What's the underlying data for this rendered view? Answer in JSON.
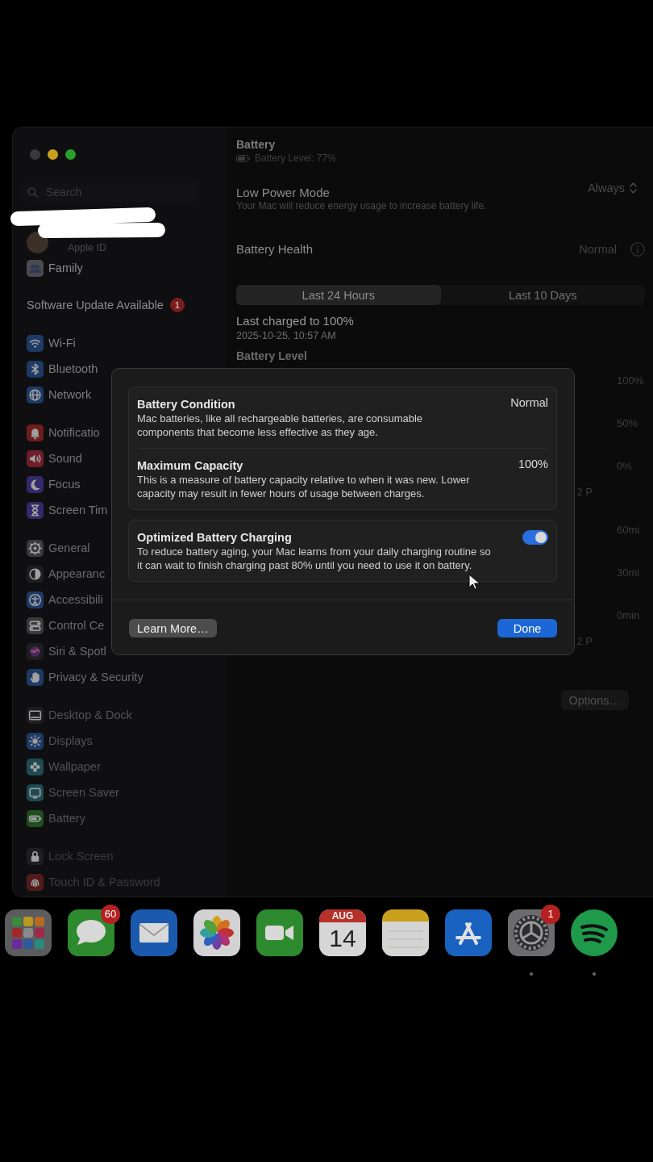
{
  "sidebar": {
    "search": {
      "placeholder": "Search"
    },
    "account": {
      "label": "Apple ID"
    },
    "family": {
      "label": "Family"
    },
    "update_notice": {
      "label": "Software Update Available",
      "badge": "1"
    },
    "groups": [
      {
        "items": [
          {
            "label": "Wi-Fi"
          },
          {
            "label": "Bluetooth"
          },
          {
            "label": "Network"
          }
        ]
      },
      {
        "items": [
          {
            "label": "Notificatio"
          },
          {
            "label": "Sound"
          },
          {
            "label": "Focus"
          },
          {
            "label": "Screen Tim"
          }
        ]
      },
      {
        "items": [
          {
            "label": "General"
          },
          {
            "label": "Appearanc"
          },
          {
            "label": "Accessibili"
          },
          {
            "label": "Control Ce"
          },
          {
            "label": "Siri & Spotl"
          },
          {
            "label": "Privacy & Security"
          }
        ]
      },
      {
        "items": [
          {
            "label": "Desktop & Dock"
          },
          {
            "label": "Displays"
          },
          {
            "label": "Wallpaper"
          },
          {
            "label": "Screen Saver"
          },
          {
            "label": "Battery"
          }
        ]
      },
      {
        "items": [
          {
            "label": "Lock Screen"
          },
          {
            "label": "Touch ID & Password"
          }
        ]
      }
    ]
  },
  "main": {
    "title": "Battery",
    "battery_level": "Battery Level: 77%",
    "low_power_mode": {
      "label": "Low Power Mode",
      "description": "Your Mac will reduce energy usage to increase battery life.",
      "value": "Always"
    },
    "battery_health": {
      "label": "Battery Health",
      "value": "Normal"
    },
    "range_tabs": [
      {
        "label": "Last 24 Hours",
        "selected": true
      },
      {
        "label": "Last 10 Days",
        "selected": false
      }
    ],
    "last_charged": {
      "label": "Last charged to 100%",
      "date": "2025-10-25, 10:57 AM"
    },
    "section_heading": "Battery Level",
    "charts": [
      {
        "y_labels": [
          "100%",
          "50%",
          "0%"
        ],
        "x_label": "2 P"
      },
      {
        "y_labels": [
          "60mi",
          "30mi",
          "0min"
        ],
        "x_label": "2 P"
      }
    ],
    "options_button": "Options…"
  },
  "dialog": {
    "cards": [
      {
        "rows": [
          {
            "kind": "value",
            "title": "Battery Condition",
            "description": "Mac batteries, like all rechargeable batteries, are consumable components that become less effective as they age.",
            "value": "Normal"
          },
          {
            "kind": "value",
            "title": "Maximum Capacity",
            "description": "This is a measure of battery capacity relative to when it was new. Lower capacity may result in fewer hours of usage between charges.",
            "value": "100%"
          }
        ]
      },
      {
        "rows": [
          {
            "kind": "toggle",
            "title": "Optimized Battery Charging",
            "description": "To reduce battery aging, your Mac learns from your daily charging routine so it can wait to finish charging past 80% until you need to use it on battery.",
            "on": true
          }
        ]
      }
    ],
    "buttons": [
      {
        "kind": "secondary",
        "label": "Learn More…"
      },
      {
        "kind": "primary",
        "label": "Done"
      }
    ]
  },
  "dock": {
    "items": [
      {
        "kind": "grid",
        "running": false
      },
      {
        "kind": "speech-bubble",
        "badge": "60",
        "running": false
      },
      {
        "kind": "envelope",
        "running": false
      },
      {
        "kind": "flower",
        "running": false
      },
      {
        "kind": "video-camera",
        "running": false
      },
      {
        "kind": "calendar",
        "month": "AUG",
        "day": "14",
        "running": false
      },
      {
        "kind": "notepad",
        "running": false
      },
      {
        "kind": "a-glyph",
        "running": false
      },
      {
        "kind": "gear",
        "badge": "1",
        "running": true
      },
      {
        "kind": "waves",
        "running": true
      }
    ]
  }
}
